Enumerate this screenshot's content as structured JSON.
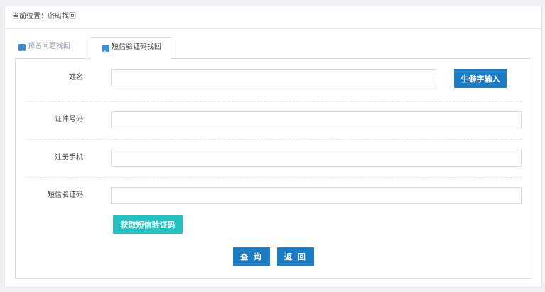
{
  "breadcrumb": "当前位置：密码找回",
  "tabs": [
    {
      "label": "预留问题找回",
      "icon": "pencil-icon"
    },
    {
      "label": "短信验证码找回",
      "icon": "phone-icon"
    }
  ],
  "form": {
    "name_label": "姓名：",
    "rare_char_button": "生僻字输入",
    "id_label": "证件号码：",
    "phone_label": "注册手机：",
    "sms_label": "短信验证码：",
    "get_sms_button": "获取短信验证码",
    "query_button": "查 询",
    "back_button": "返 回"
  },
  "colors": {
    "primary": "#1c7dc4",
    "teal": "#25c1c2",
    "icon": "#3d8fd1"
  }
}
